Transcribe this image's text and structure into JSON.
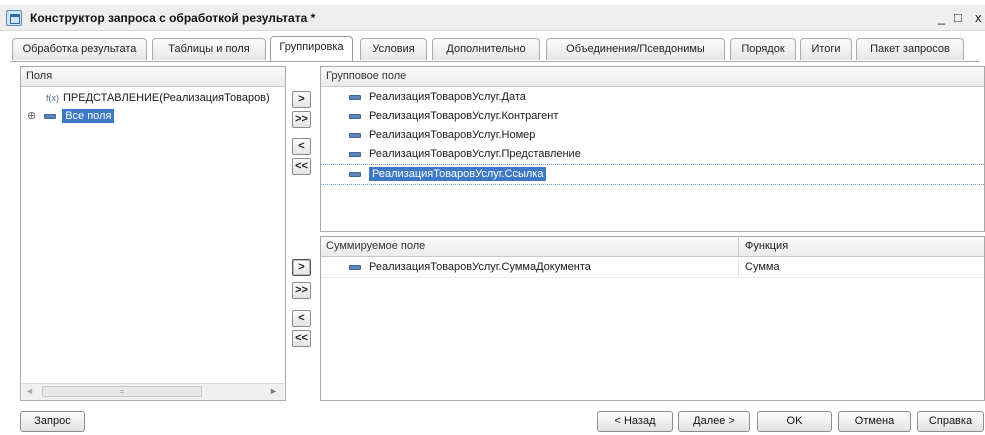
{
  "window": {
    "title": "Конструктор запроса с обработкой результата *",
    "controls": [
      "_",
      "□",
      "x"
    ]
  },
  "tabs": [
    {
      "label": "Обработка результата",
      "active": false
    },
    {
      "label": "Таблицы и поля",
      "active": false
    },
    {
      "label": "Группировка",
      "active": true
    },
    {
      "label": "Условия",
      "active": false
    },
    {
      "label": "Дополнительно",
      "active": false
    },
    {
      "label": "Объединения/Псевдонимы",
      "active": false
    },
    {
      "label": "Порядок",
      "active": false
    },
    {
      "label": "Итоги",
      "active": false
    },
    {
      "label": "Пакет запросов",
      "active": false
    }
  ],
  "fields_panel": {
    "header": "Поля",
    "items": [
      {
        "icon": "function-icon",
        "prefix": "f(x)",
        "label": "ПРЕДСТАВЛЕНИЕ(РеализацияТоваров)"
      },
      {
        "icon": "expand-icon",
        "prefix": "⊕",
        "label": "Все поля",
        "selected": true
      }
    ],
    "scrollbar_thumb": "="
  },
  "group_buttons": [
    ">",
    ">>",
    "<",
    "<<"
  ],
  "sum_buttons": [
    ">",
    ">>",
    "<",
    "<<"
  ],
  "group_panel": {
    "header": "Групповое поле",
    "items": [
      "РеализацияТоваровУслуг.Дата",
      "РеализацияТоваровУслуг.Контрагент",
      "РеализацияТоваровУслуг.Номер",
      "РеализацияТоваровУслуг.Представление",
      "РеализацияТоваровУслуг.Ссылка"
    ],
    "selected_index": 4
  },
  "sum_panel": {
    "headers": [
      "Суммируемое поле",
      "Функция"
    ],
    "rows": [
      {
        "field": "РеализацияТоваровУслуг.СуммаДокумента",
        "function": "Сумма"
      }
    ]
  },
  "bottom": {
    "query": "Запрос",
    "back": "< Назад",
    "next": "Далее >",
    "ok": "OK",
    "cancel": "Отмена",
    "help": "Справка"
  },
  "colors": {
    "selection": "#3d78c6",
    "field_icon": "#5f86b8"
  }
}
